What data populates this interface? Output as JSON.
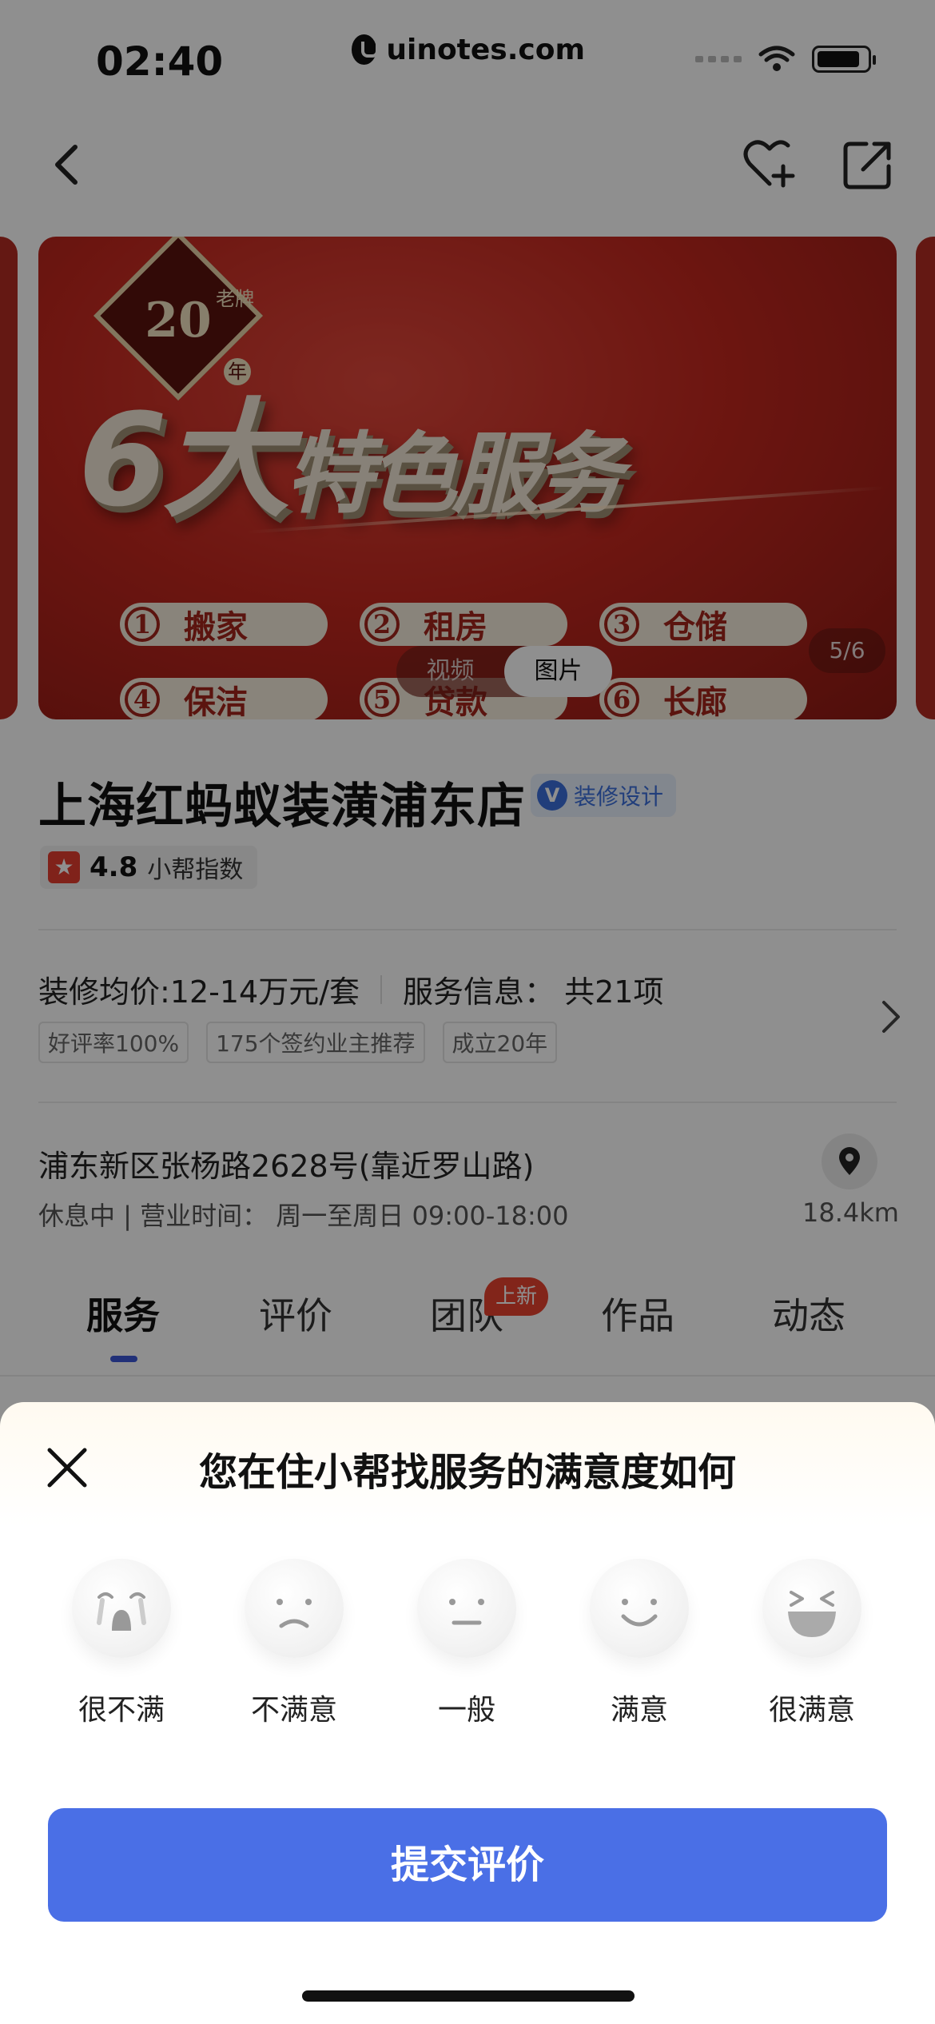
{
  "status_bar": {
    "time": "02:40",
    "watermark": "uinotes.com"
  },
  "banner": {
    "badge_number": "20",
    "badge_sub": "老牌",
    "badge_year": "年",
    "title_big": "6大",
    "title_small": "特色服务",
    "services": [
      {
        "num": "1",
        "label": "搬家"
      },
      {
        "num": "2",
        "label": "租房"
      },
      {
        "num": "3",
        "label": "仓储"
      },
      {
        "num": "4",
        "label": "保洁"
      },
      {
        "num": "5",
        "label": "贷款"
      },
      {
        "num": "6",
        "label": "长廊"
      }
    ],
    "toggle": {
      "video": "视频",
      "photo": "图片"
    },
    "counter": "5/6"
  },
  "store": {
    "name": "上海红蚂蚁装潢浦东店",
    "tag_icon": "V",
    "tag": "装修设计",
    "rating_score": "4.8",
    "rating_label": "小帮指数",
    "price": "装修均价:12-14万元/套",
    "service_info": "服务信息：  共21项",
    "tags": [
      "好评率100%",
      "175个签约业主推荐",
      "成立20年"
    ],
    "address": "浦东新区张杨路2628号(靠近罗山路)",
    "hours": "休息中 | 营业时间：  周一至周日 09:00-18:00",
    "distance": "18.4km"
  },
  "tabs": [
    {
      "label": "服务"
    },
    {
      "label": "评价"
    },
    {
      "label": "团队",
      "badge": "上新"
    },
    {
      "label": "作品"
    },
    {
      "label": "动态"
    }
  ],
  "sheet": {
    "title": "您在住小帮找服务的满意度如何",
    "options": [
      {
        "label": "很不满",
        "icon": "crying-face-icon"
      },
      {
        "label": "不满意",
        "icon": "frown-face-icon"
      },
      {
        "label": "一般",
        "icon": "neutral-face-icon"
      },
      {
        "label": "满意",
        "icon": "smile-face-icon"
      },
      {
        "label": "很满意",
        "icon": "laughing-face-icon"
      }
    ],
    "submit": "提交评价"
  }
}
